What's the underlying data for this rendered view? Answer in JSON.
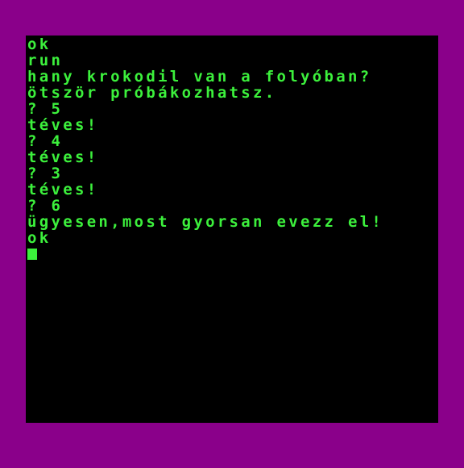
{
  "colors": {
    "border": "#8a008a",
    "screen": "#000000",
    "text": "#3cf03c"
  },
  "terminal": {
    "lines": [
      "ok",
      "run",
      "hany krokodil van a folyóban?",
      "ötször próbákozhatsz.",
      "? 5",
      "téves!",
      "? 4",
      "téves!",
      "? 3",
      "téves!",
      "? 6",
      "ügyesen,most gyorsan evezz el!",
      "ok"
    ]
  }
}
